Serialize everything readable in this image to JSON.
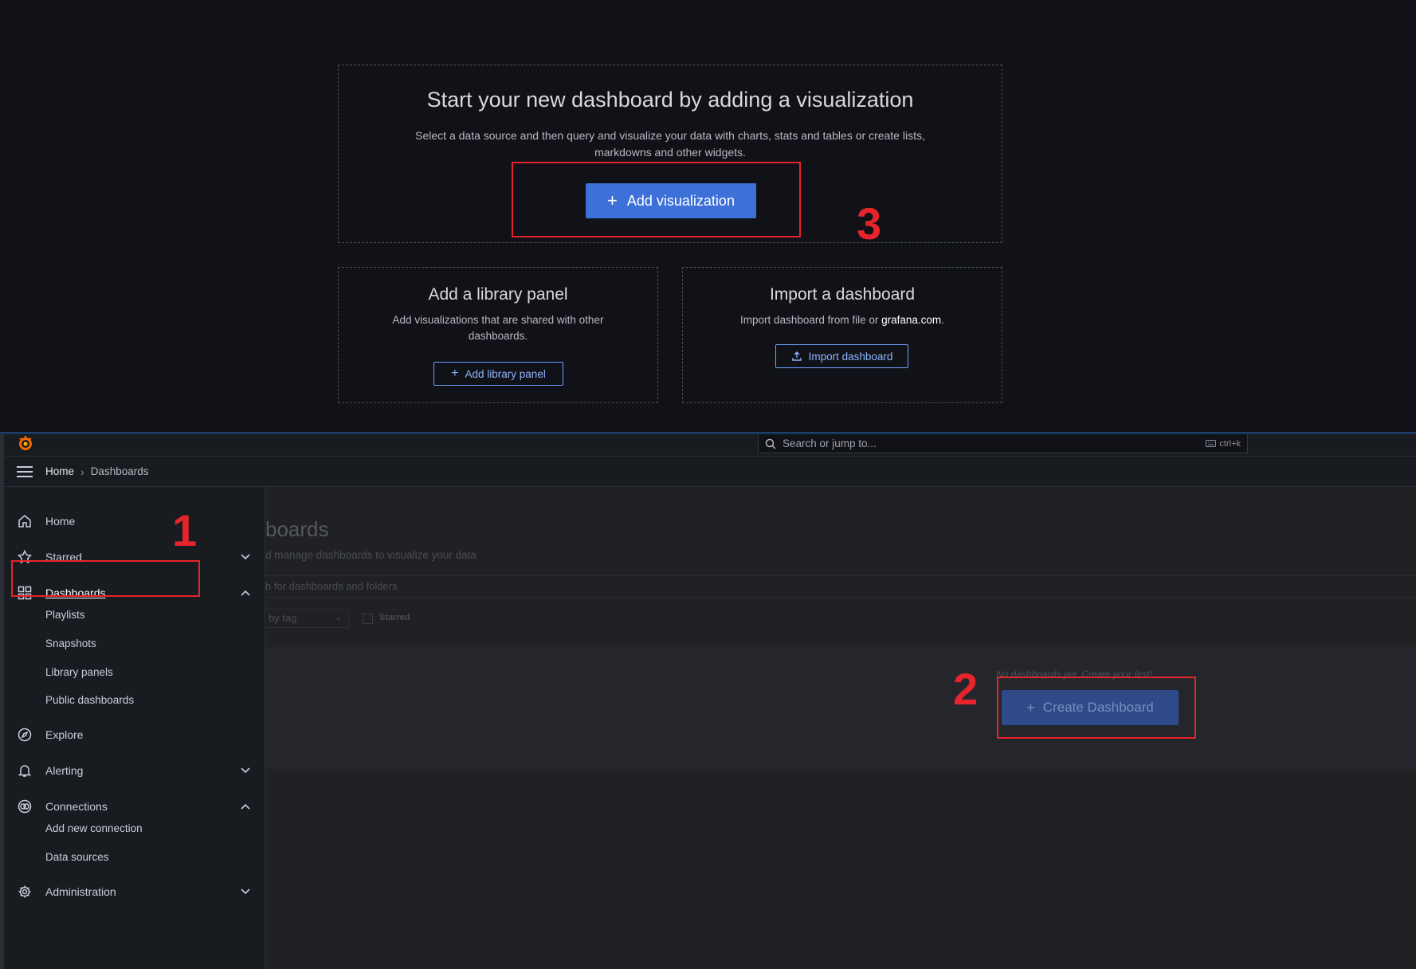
{
  "new_dashboard": {
    "title": "Start your new dashboard by adding a visualization",
    "description": "Select a data source and then query and visualize your data with charts, stats and tables or create lists, markdowns and other widgets.",
    "add_visualization_label": "Add visualization"
  },
  "library_panel": {
    "title": "Add a library panel",
    "description": "Add visualizations that are shared with other dashboards.",
    "button_label": "Add library panel"
  },
  "import_dashboard": {
    "title": "Import a dashboard",
    "description_prefix": "Import dashboard from file or ",
    "description_link": "grafana.com",
    "description_suffix": ".",
    "button_label": "Import dashboard"
  },
  "annotations": {
    "step1": "1",
    "step2": "2",
    "step3": "3",
    "color": "#e5242b"
  },
  "topbar": {
    "search_placeholder": "Search or jump to...",
    "shortcut": "ctrl+k"
  },
  "breadcrumb": {
    "home": "Home",
    "separator": "›",
    "current": "Dashboards"
  },
  "sidebar": {
    "items": [
      {
        "label": "Home",
        "icon": "home-icon"
      },
      {
        "label": "Starred",
        "icon": "star-icon"
      },
      {
        "label": "Dashboards",
        "icon": "apps-icon"
      },
      {
        "label": "Explore",
        "icon": "compass-icon"
      },
      {
        "label": "Alerting",
        "icon": "bell-icon"
      },
      {
        "label": "Connections",
        "icon": "connections-icon"
      },
      {
        "label": "Administration",
        "icon": "cog-icon"
      }
    ],
    "dashboards_children": [
      "Playlists",
      "Snapshots",
      "Library panels",
      "Public dashboards"
    ],
    "connections_children": [
      "Add new connection",
      "Data sources"
    ]
  },
  "page": {
    "title_fragment": "boards",
    "subtitle_fragment": "d manage dashboards to visualize your data",
    "search_fragment": "h for dashboards and folders",
    "filter_fragment": "by tag",
    "starred_label": "Starred",
    "empty_message": "No dashboards yet. Create your first!",
    "create_button_label": "Create Dashboard"
  },
  "colors": {
    "primary": "#3d71d9",
    "background": "#111217",
    "grafana_orange": "#f46800"
  }
}
